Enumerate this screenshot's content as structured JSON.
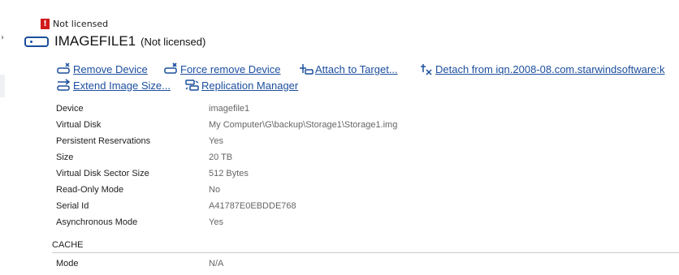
{
  "license": {
    "text": "Not licensed"
  },
  "device": {
    "name": "IMAGEFILE1",
    "status": "(Not licensed)"
  },
  "actions": [
    {
      "label": "Remove Device",
      "icon": "remove-device-icon"
    },
    {
      "label": "Force remove Device",
      "icon": "force-remove-icon"
    },
    {
      "label": "Attach to Target...",
      "icon": "attach-target-icon"
    },
    {
      "label": "Detach from iqn.2008-08.com.starwindsoftware:k",
      "icon": "detach-icon"
    },
    {
      "label": "Extend Image Size...",
      "icon": "extend-size-icon"
    },
    {
      "label": "Replication Manager",
      "icon": "replication-icon"
    }
  ],
  "properties": [
    {
      "label": "Device",
      "value": "imagefile1"
    },
    {
      "label": "Virtual Disk",
      "value": "My Computer\\G\\backup\\Storage1\\Storage1.img"
    },
    {
      "label": "Persistent Reservations",
      "value": "Yes"
    },
    {
      "label": "Size",
      "value": "20 TB"
    },
    {
      "label": "Virtual Disk Sector Size",
      "value": "512 Bytes"
    },
    {
      "label": "Read-Only Mode",
      "value": "No"
    },
    {
      "label": "Serial Id",
      "value": "A41787E0EBDDE768"
    },
    {
      "label": "Asynchronous Mode",
      "value": "Yes"
    }
  ],
  "cache": {
    "title": "CACHE",
    "rows": [
      {
        "label": "Mode",
        "value": "N/A"
      }
    ]
  },
  "colors": {
    "link": "#1c4e9d",
    "warning": "#d11a1a",
    "icon": "#1b4f9c"
  }
}
